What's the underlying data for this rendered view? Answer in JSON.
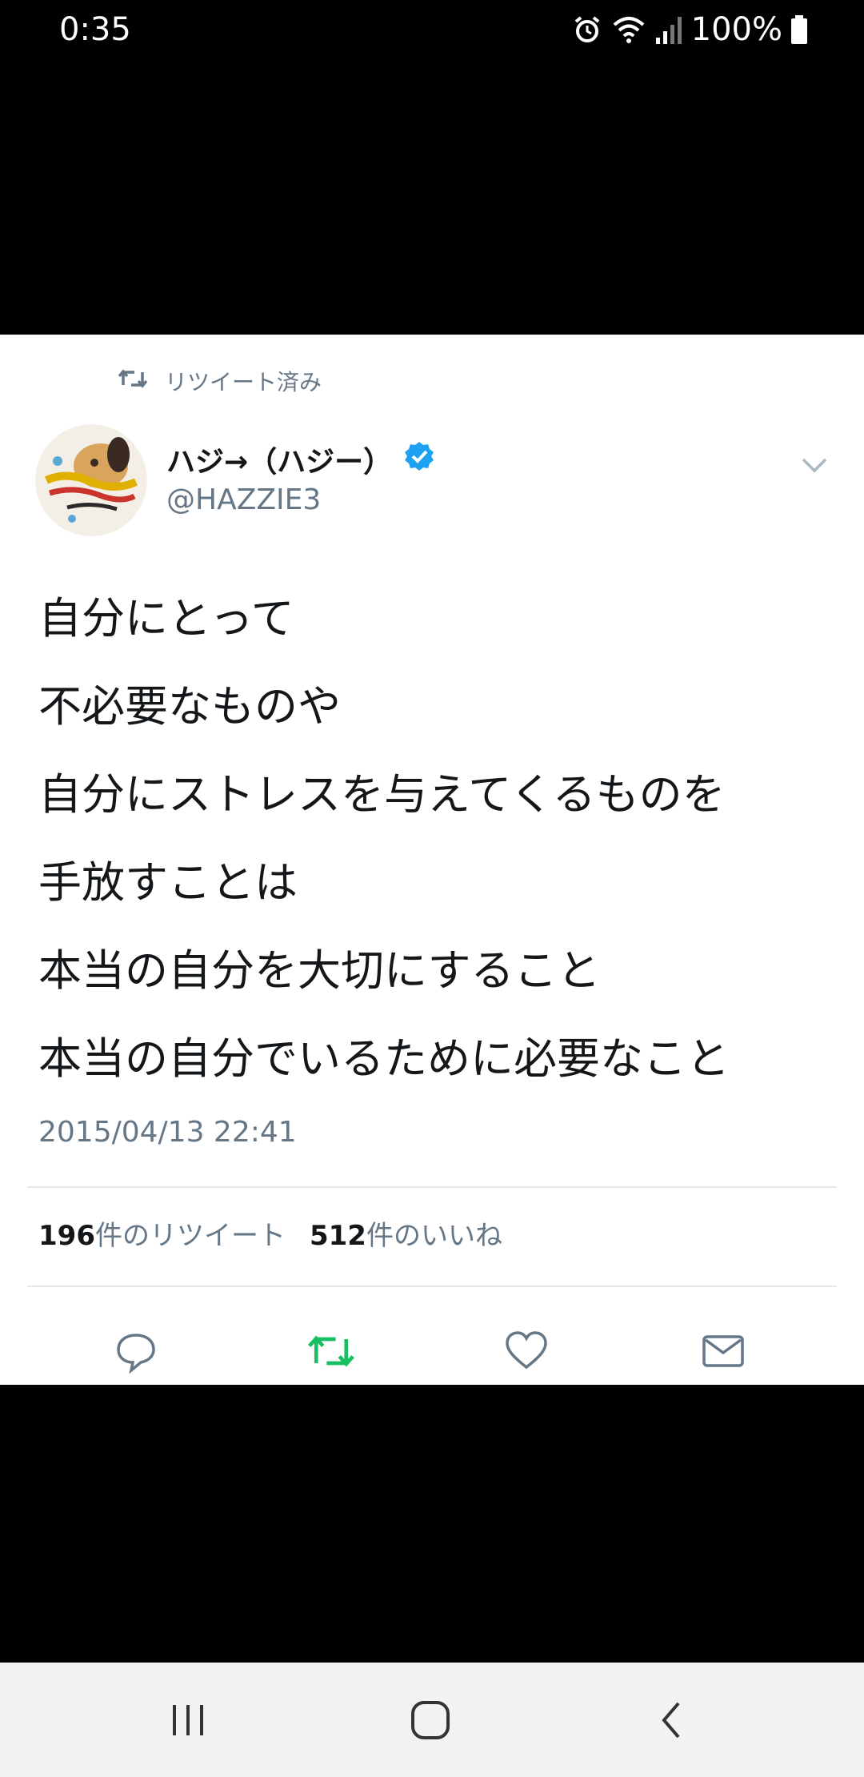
{
  "status_bar": {
    "time": "0:35",
    "battery": "100%",
    "icons": [
      "alarm-icon",
      "wifi-icon",
      "signal-icon",
      "battery-icon"
    ]
  },
  "tweet": {
    "retweet_context": "リツイート済み",
    "author_name": "ハジ→（ハジー）",
    "author_handle": "@HAZZIE3",
    "verified": true,
    "text_lines": [
      "自分にとって",
      "不必要なものや",
      "自分にストレスを与えてくるものを",
      "手放すことは",
      "本当の自分を大切にすること",
      "本当の自分でいるために必要なこと"
    ],
    "timestamp": "2015/04/13 22:41",
    "retweet_count": "196",
    "retweet_label": "件のリツイート",
    "like_count": "512",
    "like_label": "件のいいね",
    "actions": [
      "reply-icon",
      "retweet-icon",
      "like-icon",
      "message-icon"
    ]
  },
  "colors": {
    "verified_blue": "#1da1f2",
    "retweet_green": "#17bf63",
    "secondary_text": "#657786"
  },
  "nav_bar": {
    "buttons": [
      "recents-icon",
      "home-icon",
      "back-icon"
    ]
  }
}
